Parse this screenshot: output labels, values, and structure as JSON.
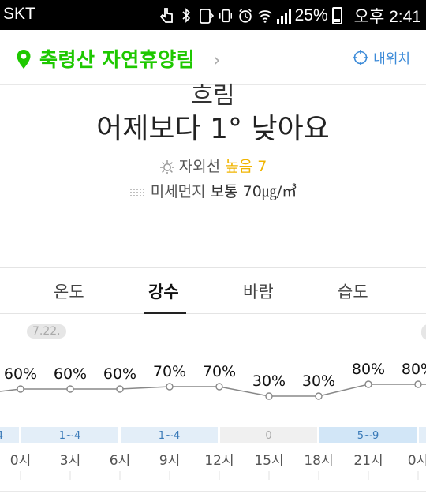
{
  "status_bar": {
    "carrier": "SKT",
    "battery": "25%",
    "time": "오후 2:41"
  },
  "header": {
    "location": "축령산 자연휴양림",
    "my_location": "내위치"
  },
  "summary": {
    "condition": "흐림",
    "compare": "어제보다 1°  낮아요",
    "uv_label": "자외선",
    "uv_level": "높음 7",
    "dust_label": "미세먼지",
    "dust_value": "보통 70㎍/㎥"
  },
  "tabs": [
    {
      "label": "온도",
      "active": false
    },
    {
      "label": "강수",
      "active": true
    },
    {
      "label": "바람",
      "active": false
    },
    {
      "label": "습도",
      "active": false
    }
  ],
  "chart_data": {
    "type": "line",
    "date_label": "7.22.",
    "x": [
      "0시",
      "3시",
      "6시",
      "9시",
      "12시",
      "15시",
      "18시",
      "21시",
      "0시"
    ],
    "series": [
      {
        "values": [
          60,
          60,
          60,
          70,
          70,
          30,
          30,
          80,
          80
        ]
      }
    ],
    "precip_bands": [
      {
        "label": "4",
        "highlight": true
      },
      {
        "label": "1~4",
        "highlight": true
      },
      {
        "label": "1~4",
        "highlight": true
      },
      {
        "label": "0",
        "highlight": false
      },
      {
        "label": "5~9",
        "highlight": true
      },
      {
        "label": "",
        "highlight": true
      }
    ],
    "value_suffix": "%",
    "colors": {
      "line": "#888888",
      "band_light": "#e3eef8",
      "band_strong": "#d2e6f7",
      "band_text": "#3a7ab8",
      "band_gray": "#f0f0f0"
    }
  }
}
